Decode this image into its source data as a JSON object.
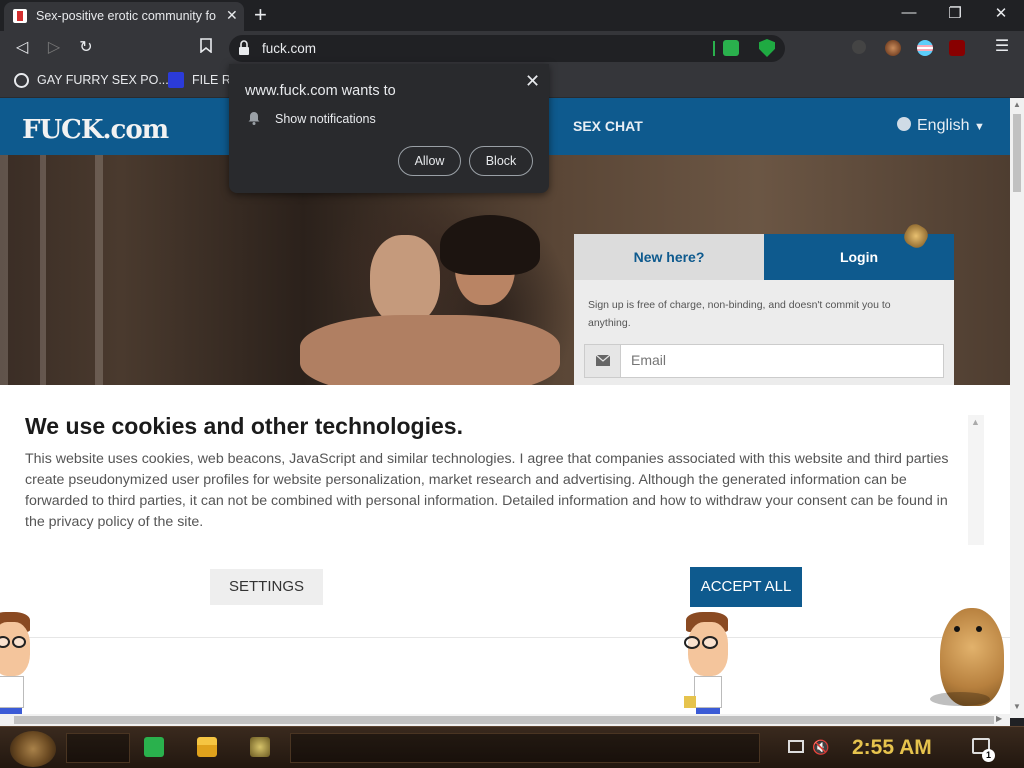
{
  "browser": {
    "tab_title": "Sex-positive erotic community for",
    "url": "fuck.com",
    "bookmarks": [
      "GAY FURRY SEX PO...",
      "FILE RC"
    ]
  },
  "notification": {
    "title": "www.fuck.com wants to",
    "permission": "Show notifications",
    "allow_label": "Allow",
    "block_label": "Block"
  },
  "site": {
    "logo_main": "FUCK",
    "logo_suffix": ".com",
    "nav_sex_chat": "SEX CHAT",
    "language": "English",
    "tab_new": "New here?",
    "tab_login": "Login",
    "signup_note": "Sign up is free of charge, non-binding, and doesn't commit you to anything.",
    "email_placeholder": "Email"
  },
  "cookie": {
    "title": "We use cookies and other technologies.",
    "body": "This website uses cookies, web beacons, JavaScript and similar technologies. I agree that companies associated with this website and third parties create pseudonymized user profiles for website personalization, market research and advertising. Although the generated information can be forwarded to third parties, it can not be combined with personal information. Detailed information and how to withdraw your consent can be found in the privacy policy of the site.",
    "settings_label": "SETTINGS",
    "accept_label": "ACCEPT ALL"
  },
  "taskbar": {
    "clock": "2:55 AM",
    "notification_count": "1"
  },
  "colors": {
    "brand_blue": "#0e5a8e",
    "browser_dark": "#202124",
    "clock_gold": "#e6c34d"
  }
}
